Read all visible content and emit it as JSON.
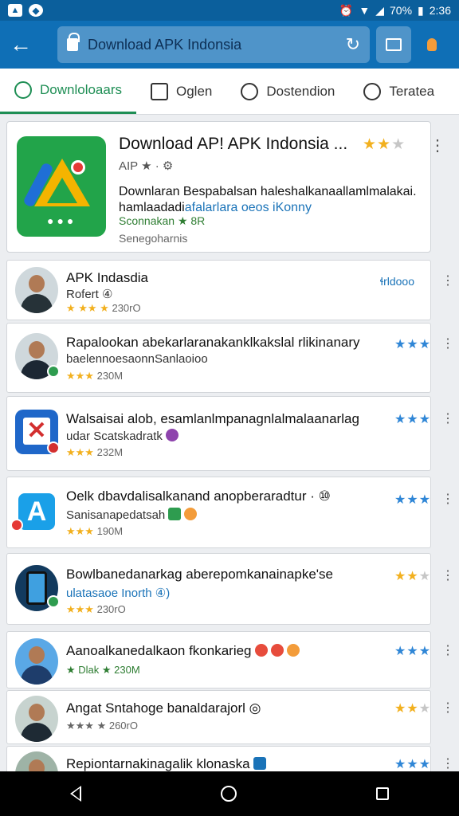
{
  "status_bar": {
    "time": "2:36",
    "battery": "70%"
  },
  "toolbar": {
    "url": "Download APK Indonsia"
  },
  "tabs": [
    {
      "label": "Downloloaars"
    },
    {
      "label": "Oglen"
    },
    {
      "label": "Dostendion"
    },
    {
      "label": "Teratea"
    }
  ],
  "featured": {
    "title": "Download AP! APK Indonsia ...",
    "sub": "AIP ★ · ⚙",
    "desc_line1": "Downlaran Bespabalsan haleshalkanaallamlmalakai.",
    "desc_line2_a": "hamlaadadi",
    "desc_line2_b": "afalarlara oeos iKonny",
    "meta": "Sconnakan ★ 8R",
    "developer": "Senegoharnis",
    "rating_on": "★★",
    "rating_off": "★"
  },
  "apps": [
    {
      "title": "APK Indasdia",
      "line2": "Rofert ④",
      "rating_stars": "★ ★★ ★",
      "size": "230rO",
      "tag": "ɬrldooo",
      "stars_on": "",
      "stars_off": ""
    },
    {
      "title": "Rapalookan abekarlaranakanklkakslal rlikinanary",
      "line2": "baelennoesaonnSanlaoioo",
      "rating_stars": "★★★",
      "size": "230M",
      "tag": "",
      "stars_on": "★★★",
      "stars_off": ""
    },
    {
      "title": "Walsaisai alob, esamlanlmpanagnlalmalaanarlag",
      "line2": "udar Scatskadratk",
      "rating_stars": "★★★",
      "size": "232M",
      "tag": "",
      "stars_on": "★★★",
      "stars_off": ""
    },
    {
      "title": "Oelk dbavdalisalkanand anopberaradtur · ⑩",
      "line2": "Sanisanapedatsah",
      "rating_stars": "★★★",
      "size": "190M",
      "tag": "",
      "stars_on": "★★★",
      "stars_off": ""
    },
    {
      "title": "Bowlbanedanarkag aberepomkanainapke'se",
      "line2": "ulatasaoe Inorth ④)",
      "rating_stars": "★★★",
      "size": "230rO",
      "tag": "",
      "stars_on": "★★",
      "stars_off": "★"
    },
    {
      "title": "Aanoalkanedalkaon fkonkarieg",
      "line2": "★ Dlak ★ 230M",
      "rating_stars": "",
      "size": "",
      "tag": "",
      "stars_on": "★★★",
      "stars_off": ""
    },
    {
      "title": "Angat Sntahoge banaldarajorl ◎",
      "line2": "★★★ ★ 260rO",
      "rating_stars": "",
      "size": "",
      "tag": "",
      "stars_on": "★★",
      "stars_off": "★"
    },
    {
      "title": "Repiontarnakinagalik klonaska",
      "line2": "",
      "rating_stars": "",
      "size": "",
      "tag": "",
      "stars_on": "★★★",
      "stars_off": ""
    }
  ]
}
